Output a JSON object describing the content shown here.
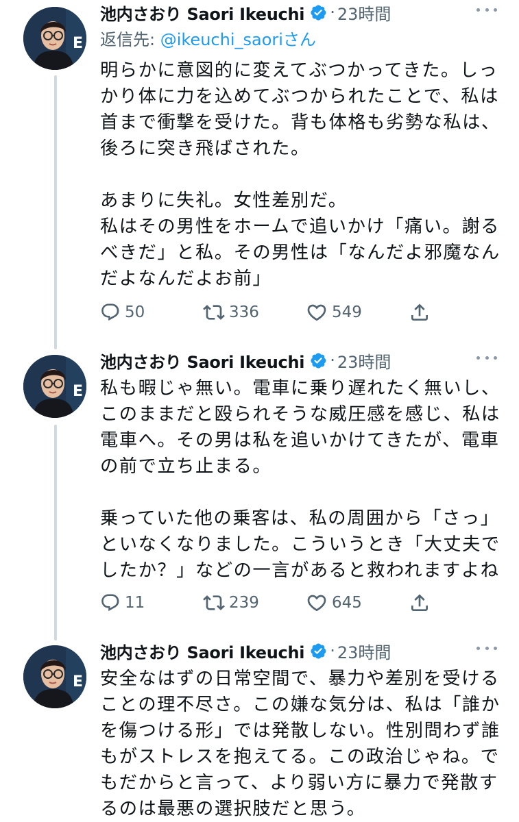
{
  "colors": {
    "link": "#1d9bf0",
    "secondary_text": "#536471",
    "thread_line": "#cfd9de",
    "verified_badge": "#1d9bf0"
  },
  "tweets": [
    {
      "author_name": "池内さおり Saori Ikeuchi",
      "dot": "·",
      "time": "23時間",
      "reply_prefix": "返信先: ",
      "reply_handle": "@ikeuchi_saori",
      "reply_suffix": "さん",
      "text": "明らかに意図的に変えてぶつかってきた。しっかり体に力を込めてぶつかられたことで、私は首まで衝撃を受けた。背も体格も劣勢な私は、後ろに突き飛ばされた。\n\nあまりに失礼。女性差別だ。\n私はその男性をホームで追いかけ「痛い。謝るべきだ」と私。その男性は「なんだよ邪魔なんだよなんだよお前」",
      "replies": "50",
      "retweets": "336",
      "likes": "549"
    },
    {
      "author_name": "池内さおり Saori Ikeuchi",
      "dot": "·",
      "time": "23時間",
      "text": "私も暇じゃ無い。電車に乗り遅れたく無いし、このままだと殴られそうな威圧感を感じ、私は電車へ。その男は私を追いかけてきたが、電車の前で立ち止まる。\n\n乗っていた他の乗客は、私の周囲から「さっ」といなくなりました。こういうとき「大丈夫でしたか？」などの一言があると救われますよね",
      "replies": "11",
      "retweets": "239",
      "likes": "645"
    },
    {
      "author_name": "池内さおり Saori Ikeuchi",
      "dot": "·",
      "time": "23時間",
      "text": "安全なはずの日常空間で、暴力や差別を受けることの理不尽さ。この嫌な気分は、私は「誰かを傷つける形」では発散しない。性別問わず誰もがストレスを抱えてる。この政治じゃね。でもだからと言って、より弱い方に暴力で発散するのは最悪の選択肢だと思う。"
    }
  ]
}
